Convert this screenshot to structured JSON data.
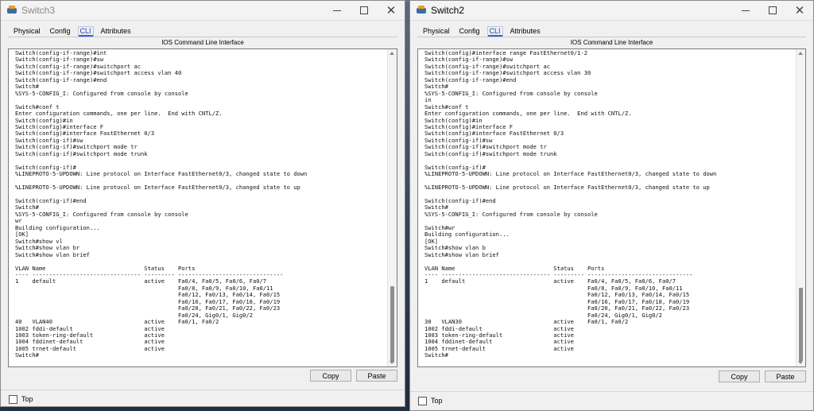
{
  "switch3": {
    "title": "Switch3",
    "tabs": [
      "Physical",
      "Config",
      "CLI",
      "Attributes"
    ],
    "active_tab": "CLI",
    "panel_title": "IOS Command Line Interface",
    "terminal": "Switch(config-if-range)#int\nSwitch(config-if-range)#sw\nSwitch(config-if-range)#switchport ac\nSwitch(config-if-range)#switchport access vlan 40\nSwitch(config-if-range)#end\nSwitch#\n%SYS-5-CONFIG_I: Configured from console by console\n\nSwitch#conf t\nEnter configuration commands, one per line.  End with CNTL/Z.\nSwitch(config)#in\nSwitch(config)#interface F\nSwitch(config)#interface FastEthernet 0/3\nSwitch(config-if)#sw\nSwitch(config-if)#switchport mode tr\nSwitch(config-if)#switchport mode trunk\n\nSwitch(config-if)#\n%LINEPROTO-5-UPDOWN: Line protocol on Interface FastEthernet0/3, changed state to down\n\n%LINEPROTO-5-UPDOWN: Line protocol on Interface FastEthernet0/3, changed state to up\n\nSwitch(config-if)#end\nSwitch#\n%SYS-5-CONFIG_I: Configured from console by console\nwr\nBuilding configuration...\n[OK]\nSwitch#show vl\nSwitch#show vlan br\nSwitch#show vlan brief\n\nVLAN Name                             Status    Ports\n---- -------------------------------- --------- -------------------------------\n1    default                          active    Fa0/4, Fa0/5, Fa0/6, Fa0/7\n                                                Fa0/8, Fa0/9, Fa0/10, Fa0/11\n                                                Fa0/12, Fa0/13, Fa0/14, Fa0/15\n                                                Fa0/16, Fa0/17, Fa0/18, Fa0/19\n                                                Fa0/20, Fa0/21, Fa0/22, Fa0/23\n                                                Fa0/24, Gig0/1, Gig0/2\n40   VLAN40                           active    Fa0/1, Fa0/2\n1002 fddi-default                     active\n1003 token-ring-default               active\n1004 fddinet-default                  active\n1005 trnet-default                    active\nSwitch#",
    "copy_label": "Copy",
    "paste_label": "Paste",
    "top_label": "Top"
  },
  "switch2": {
    "title": "Switch2",
    "tabs": [
      "Physical",
      "Config",
      "CLI",
      "Attributes"
    ],
    "active_tab": "CLI",
    "panel_title": "IOS Command Line Interface",
    "terminal": "Switch(config)#interface range FastEthernet0/1-2\nSwitch(config-if-range)#sw\nSwitch(config-if-range)#switchport ac\nSwitch(config-if-range)#switchport access vlan 30\nSwitch(config-if-range)#end\nSwitch#\n%SYS-5-CONFIG_I: Configured from console by console\nin\nSwitch#conf t\nEnter configuration commands, one per line.  End with CNTL/Z.\nSwitch(config)#in\nSwitch(config)#interface F\nSwitch(config)#interface FastEthernet 0/3\nSwitch(config-if)#sw\nSwitch(config-if)#switchport mode tr\nSwitch(config-if)#switchport mode trunk\n\nSwitch(config-if)#\n%LINEPROTO-5-UPDOWN: Line protocol on Interface FastEthernet0/3, changed state to down\n\n%LINEPROTO-5-UPDOWN: Line protocol on Interface FastEthernet0/3, changed state to up\n\nSwitch(config-if)#end\nSwitch#\n%SYS-5-CONFIG_I: Configured from console by console\n\nSwitch#wr\nBuilding configuration...\n[OK]\nSwitch#show vlan b\nSwitch#show vlan brief\n\nVLAN Name                             Status    Ports\n---- -------------------------------- --------- -------------------------------\n1    default                          active    Fa0/4, Fa0/5, Fa0/6, Fa0/7\n                                                Fa0/8, Fa0/9, Fa0/10, Fa0/11\n                                                Fa0/12, Fa0/13, Fa0/14, Fa0/15\n                                                Fa0/16, Fa0/17, Fa0/18, Fa0/19\n                                                Fa0/20, Fa0/21, Fa0/22, Fa0/23\n                                                Fa0/24, Gig0/1, Gig0/2\n30   VLAN30                           active    Fa0/1, Fa0/2\n1002 fddi-default                     active\n1003 token-ring-default               active\n1004 fddinet-default                  active\n1005 trnet-default                    active\nSwitch#",
    "copy_label": "Copy",
    "paste_label": "Paste",
    "top_label": "Top"
  },
  "icons": {
    "app": "packet-tracer-icon",
    "minimize": "minimize-icon",
    "maximize": "maximize-icon",
    "close": "close-icon"
  }
}
